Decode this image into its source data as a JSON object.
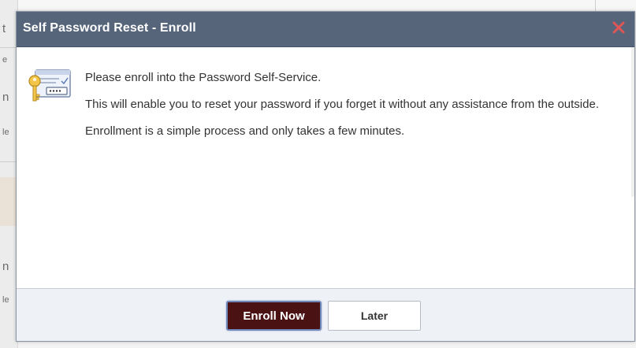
{
  "background": {
    "fragments": [
      "t",
      "e",
      "n",
      "le",
      "n",
      "le"
    ]
  },
  "dialog": {
    "title": "Self Password Reset - Enroll",
    "close_icon": "close-x-icon",
    "body_icon": "key-password-icon",
    "paragraphs": [
      "Please enroll into the Password Self-Service.",
      "This will enable you to reset your password if you forget it without any assistance from the outside.",
      "Enrollment is a simple process and only takes a few minutes."
    ],
    "buttons": {
      "enroll_label": "Enroll Now",
      "later_label": "Later"
    }
  },
  "colors": {
    "header": "#56657a",
    "close": "#d9534f",
    "primary_button": "#4a1212",
    "footer": "#eef1f5"
  }
}
